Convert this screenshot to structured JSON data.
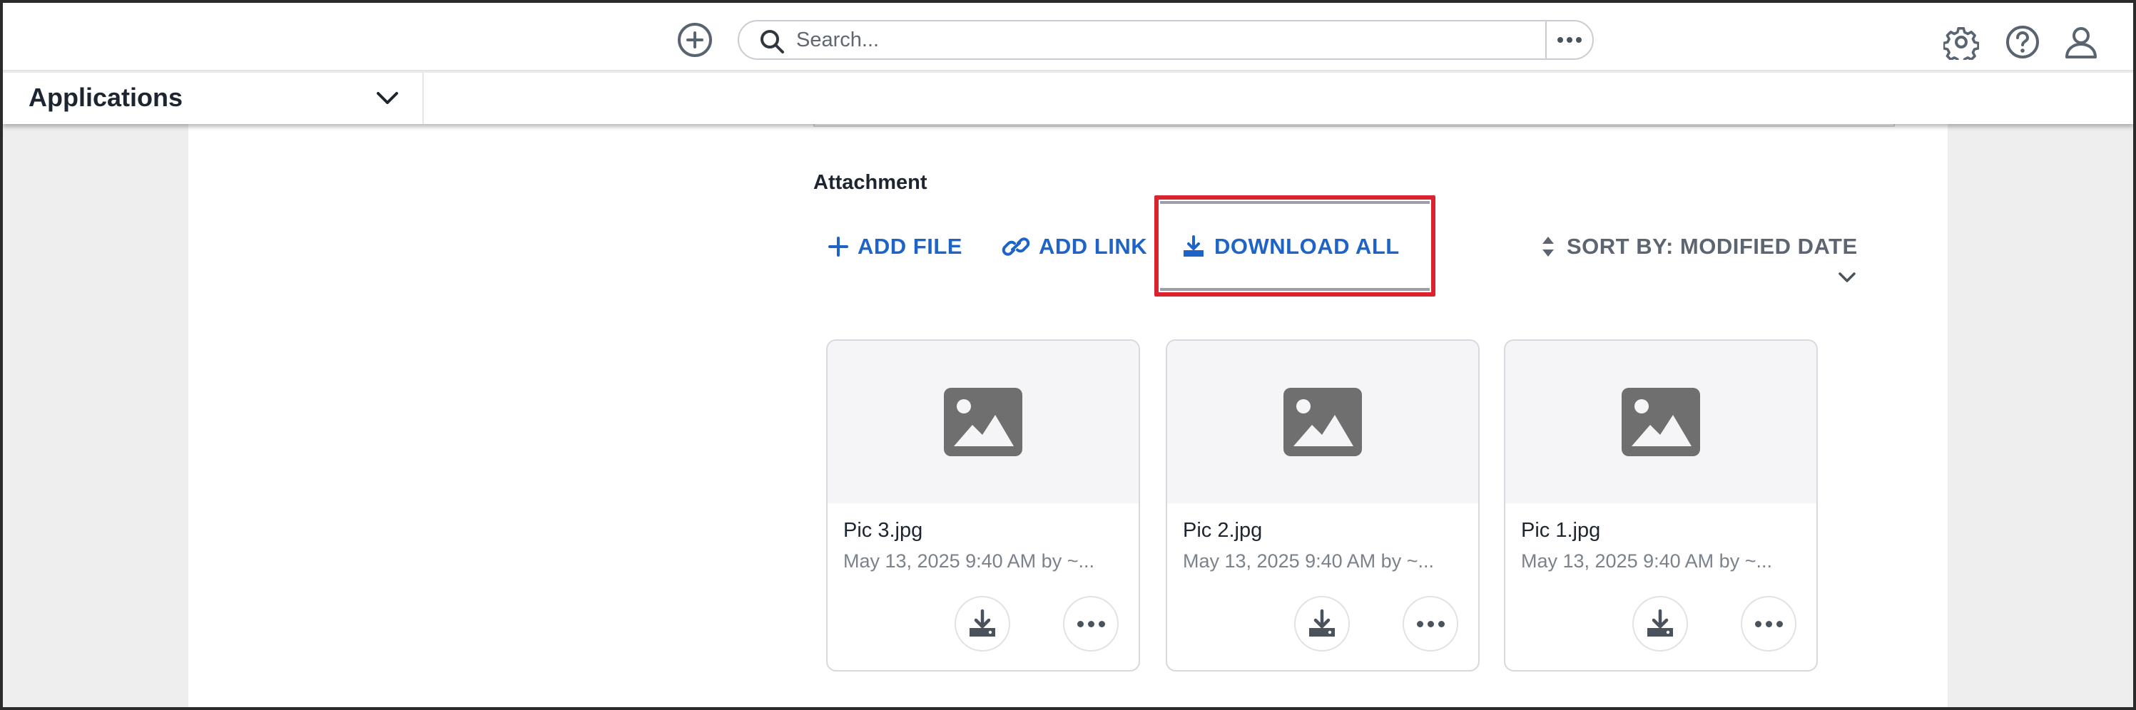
{
  "header": {
    "add_icon": "plus-circle-icon",
    "search": {
      "placeholder": "Search...",
      "value": ""
    },
    "more_icon": "ellipsis-icon",
    "right_icons": [
      "gear-icon",
      "help-icon",
      "user-icon"
    ]
  },
  "appbar": {
    "label": "Applications",
    "chevron_icon": "chevron-down-icon"
  },
  "attachments": {
    "title": "Attachment",
    "actions": {
      "add_file": "ADD FILE",
      "add_link": "ADD LINK",
      "download_all": "DOWNLOAD ALL"
    },
    "sort_label": "SORT BY: MODIFIED DATE",
    "highlight_color": "#d9232e",
    "accent_color": "#1e64c8",
    "files": [
      {
        "name": "Pic 3.jpg",
        "meta": "May 13, 2025 9:40 AM by ~..."
      },
      {
        "name": "Pic 2.jpg",
        "meta": "May 13, 2025 9:40 AM by ~..."
      },
      {
        "name": "Pic 1.jpg",
        "meta": "May 13, 2025 9:40 AM by ~..."
      }
    ]
  }
}
